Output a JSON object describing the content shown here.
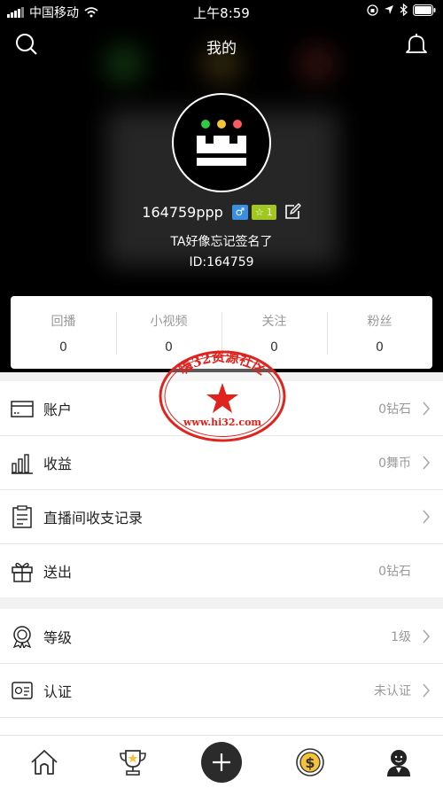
{
  "status_bar": {
    "carrier": "中国移动",
    "time": "上午8:59"
  },
  "header": {
    "title": "我的",
    "search_icon": "search-icon",
    "bell_icon": "bell-icon"
  },
  "profile": {
    "username": "164759ppp",
    "gender_symbol": "♂",
    "level_star": "☆",
    "level": "1",
    "signature": "TA好像忘记签名了",
    "user_id": "ID:164759",
    "colors": {
      "dot_green": "#2ecc40",
      "dot_yellow": "#f5c33b",
      "dot_red": "#ff5a5f"
    }
  },
  "stats": [
    {
      "label": "回播",
      "value": "0"
    },
    {
      "label": "小视频",
      "value": "0"
    },
    {
      "label": "关注",
      "value": "0"
    },
    {
      "label": "粉丝",
      "value": "0"
    }
  ],
  "menu_group_1": [
    {
      "label": "账户",
      "value": "0钻石",
      "icon": "wallet-icon",
      "chevron": true
    },
    {
      "label": "收益",
      "value": "0舞币",
      "icon": "bar-chart-icon",
      "chevron": true
    },
    {
      "label": "直播间收支记录",
      "value": "",
      "icon": "clipboard-icon",
      "chevron": true
    },
    {
      "label": "送出",
      "value": "0钻石",
      "icon": "gift-icon",
      "chevron": false
    }
  ],
  "menu_group_2": [
    {
      "label": "等级",
      "value": "1级",
      "icon": "medal-icon",
      "chevron": true
    },
    {
      "label": "认证",
      "value": "未认证",
      "icon": "certificate-icon",
      "chevron": true
    }
  ],
  "watermark": {
    "title": "嗨32资源社区",
    "url": "www.hi32.com",
    "color": "#e0231c"
  },
  "tabbar": [
    {
      "name": "home",
      "icon": "home-icon"
    },
    {
      "name": "rank",
      "icon": "trophy-icon"
    },
    {
      "name": "publish",
      "icon": "plus-icon"
    },
    {
      "name": "coin",
      "icon": "dollar-coin-icon"
    },
    {
      "name": "mine",
      "icon": "user-icon"
    }
  ],
  "accent": "#222222"
}
